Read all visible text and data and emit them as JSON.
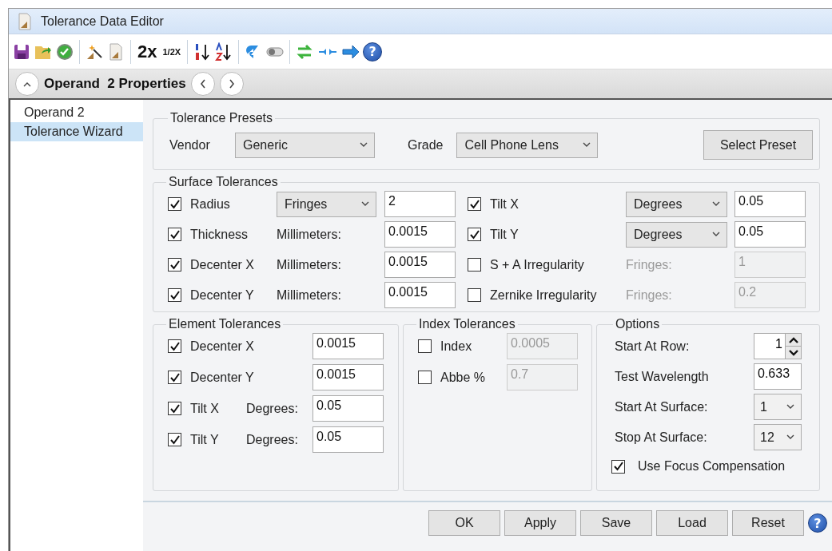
{
  "window": {
    "title": "Tolerance Data Editor"
  },
  "toolbar": {
    "zoom_in": "2x",
    "zoom_out": "1/2X",
    "help": "?"
  },
  "properties_bar": {
    "title": "Operand  2 Properties"
  },
  "sidebar": {
    "items": [
      {
        "label": "Operand 2",
        "selected": false
      },
      {
        "label": "Tolerance Wizard",
        "selected": true
      }
    ]
  },
  "tolerance_presets": {
    "title": "Tolerance Presets",
    "vendor": {
      "label": "Vendor",
      "value": "Generic"
    },
    "grade": {
      "label": "Grade",
      "value": "Cell Phone Lens"
    },
    "button": "Select Preset"
  },
  "surface_tolerances": {
    "title": "Surface Tolerances",
    "rows": [
      {
        "label": "Radius",
        "checked": true,
        "kind": "dropdown",
        "unit": "Fringes",
        "value": "2",
        "disabled": false
      },
      {
        "label": "Tilt X",
        "checked": true,
        "kind": "dropdown",
        "unit": "Degrees",
        "value": "0.05",
        "disabled": false
      },
      {
        "label": "Thickness",
        "checked": true,
        "kind": "label",
        "unit": "Millimeters:",
        "value": "0.0015",
        "disabled": false
      },
      {
        "label": "Tilt Y",
        "checked": true,
        "kind": "dropdown",
        "unit": "Degrees",
        "value": "0.05",
        "disabled": false
      },
      {
        "label": "Decenter X",
        "checked": true,
        "kind": "label",
        "unit": "Millimeters:",
        "value": "0.0015",
        "disabled": false
      },
      {
        "label": "S + A Irregularity",
        "checked": false,
        "kind": "label",
        "unit": "Fringes:",
        "value": "1",
        "disabled": true
      },
      {
        "label": "Decenter Y",
        "checked": true,
        "kind": "label",
        "unit": "Millimeters:",
        "value": "0.0015",
        "disabled": false
      },
      {
        "label": "Zernike Irregularity",
        "checked": false,
        "kind": "label",
        "unit": "Fringes:",
        "value": "0.2",
        "disabled": true
      }
    ]
  },
  "element_tolerances": {
    "title": "Element Tolerances",
    "rows": [
      {
        "label": "Decenter X",
        "checked": true,
        "value": "0.0015"
      },
      {
        "label": "Decenter Y",
        "checked": true,
        "value": "0.0015"
      },
      {
        "label": "Tilt X",
        "checked": true,
        "unit": "Degrees:",
        "value": "0.05"
      },
      {
        "label": "Tilt Y",
        "checked": true,
        "unit": "Degrees:",
        "value": "0.05"
      }
    ]
  },
  "index_tolerances": {
    "title": "Index Tolerances",
    "rows": [
      {
        "label": "Index",
        "checked": false,
        "value": "0.0005",
        "disabled": true
      },
      {
        "label": "Abbe %",
        "checked": false,
        "value": "0.7",
        "disabled": true
      }
    ]
  },
  "options": {
    "title": "Options",
    "rows": [
      {
        "kind": "spinner",
        "label": "Start At Row:",
        "value": "1"
      },
      {
        "kind": "field",
        "label": "Test Wavelength",
        "value": "0.633"
      },
      {
        "kind": "dropdown",
        "label": "Start At Surface:",
        "value": "1"
      },
      {
        "kind": "dropdown",
        "label": "Stop At Surface:",
        "value": "12"
      }
    ],
    "focus_compensation": {
      "label": "Use Focus Compensation",
      "checked": true
    }
  },
  "buttons": [
    "OK",
    "Apply",
    "Save",
    "Load",
    "Reset"
  ],
  "footer_help": "?"
}
